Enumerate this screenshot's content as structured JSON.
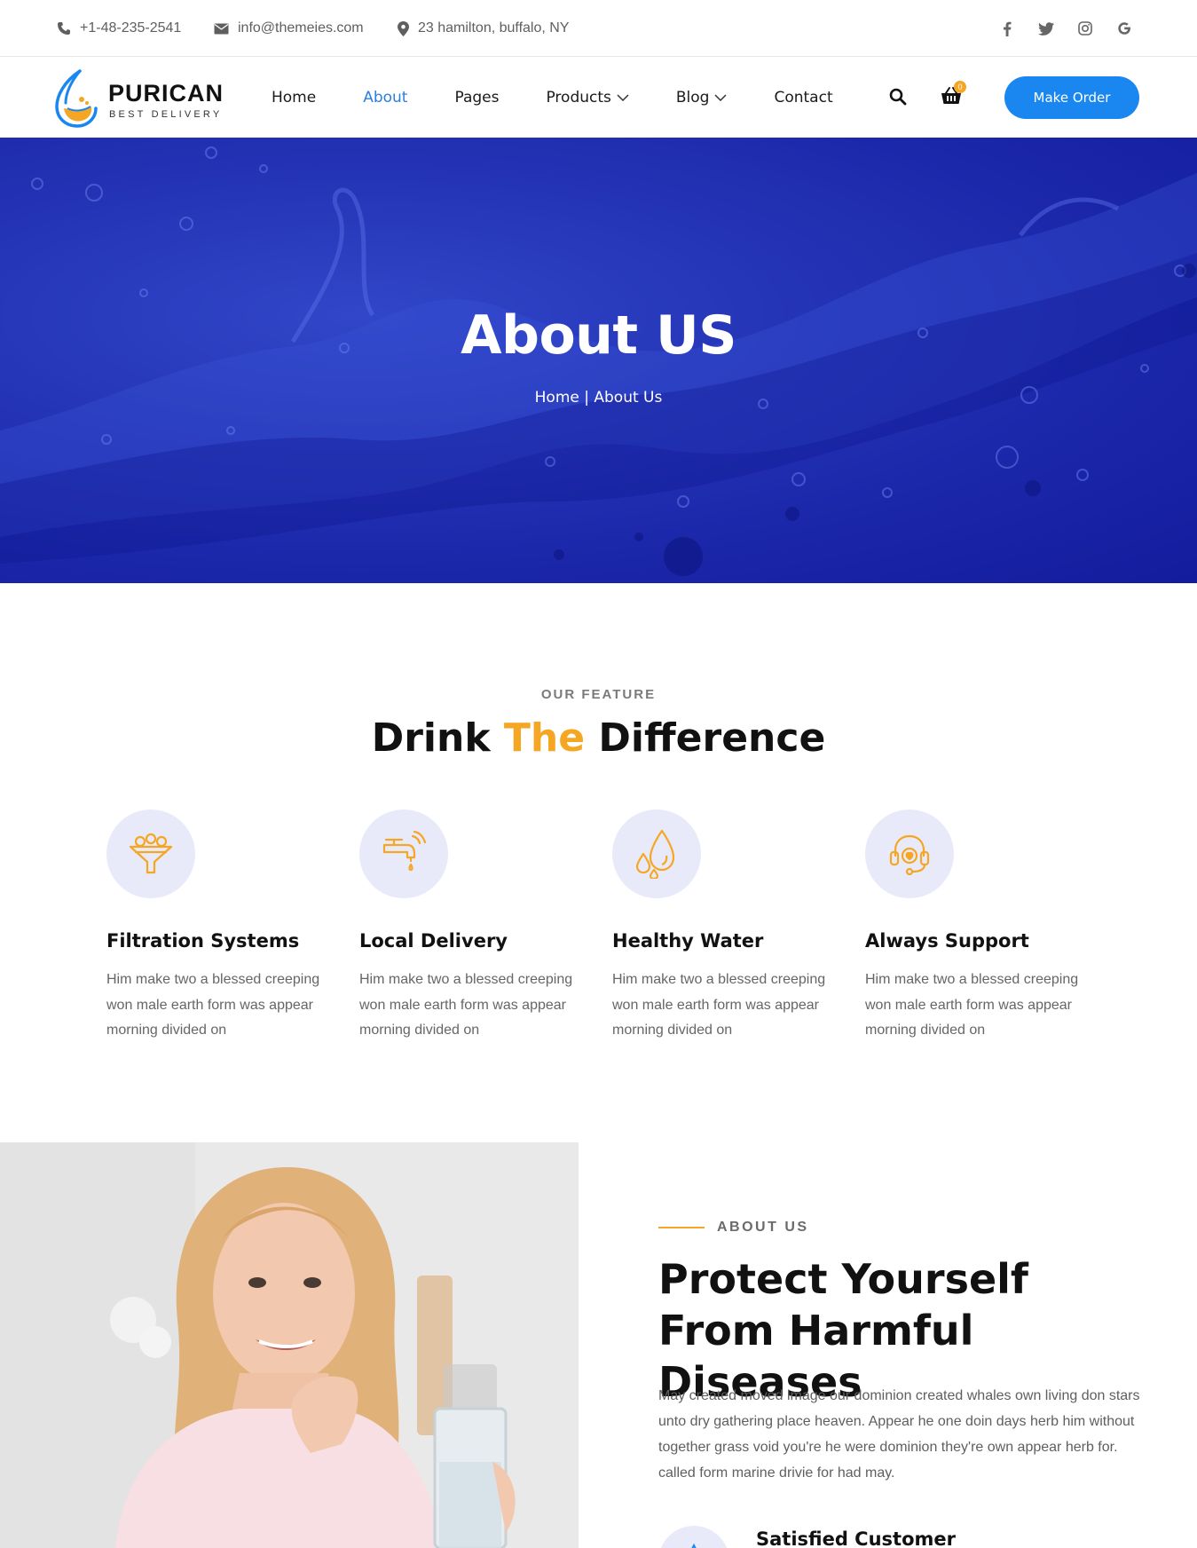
{
  "topbar": {
    "phone": "+1-48-235-2541",
    "email": "info@themeies.com",
    "address": "23 hamilton, buffalo, NY",
    "socials": [
      "facebook-icon",
      "twitter-icon",
      "instagram-icon",
      "google-icon"
    ]
  },
  "nav": {
    "brand": "PURICAN",
    "tagline": "BEST DELIVERY",
    "items": [
      {
        "label": "Home",
        "active": false,
        "dropdown": false
      },
      {
        "label": "About",
        "active": true,
        "dropdown": false
      },
      {
        "label": "Pages",
        "active": false,
        "dropdown": false
      },
      {
        "label": "Products",
        "active": false,
        "dropdown": true
      },
      {
        "label": "Blog",
        "active": false,
        "dropdown": true
      },
      {
        "label": "Contact",
        "active": false,
        "dropdown": false
      }
    ],
    "cart_count": "0",
    "cta_label": "Make Order"
  },
  "hero": {
    "title": "About US",
    "breadcrumb": "Home | About Us"
  },
  "features": {
    "eyebrow": "OUR FEATURE",
    "title_part1": "Drink ",
    "title_highlight": "The",
    "title_part2": " Difference",
    "items": [
      {
        "icon": "filter-icon",
        "title": "Filtration Systems",
        "text": "Him make two a blessed creeping won male earth form was appear morning divided on"
      },
      {
        "icon": "faucet-icon",
        "title": "Local Delivery",
        "text": "Him make two a blessed creeping won male earth form was appear morning divided on"
      },
      {
        "icon": "water-drops-icon",
        "title": "Healthy Water",
        "text": "Him make two a blessed creeping won male earth form was appear morning divided on"
      },
      {
        "icon": "support-headset-icon",
        "title": "Always Support",
        "text": "Him make two a blessed creeping won male earth form was appear morning divided on"
      }
    ]
  },
  "about": {
    "eyebrow": "ABOUT US",
    "title": "Protect Yourself From Harmful Diseases",
    "text": "May created moved image our dominion created whales own living don stars unto dry gathering place heaven. Appear he one doin days herb him without together grass void you're he were dominion they're own appear herb for. called form marine drivie for had may.",
    "stat_title": "Satisfied Customer"
  },
  "colors": {
    "accent": "#1a87f0",
    "highlight": "#f5a623",
    "hero_blue": "#2535b7",
    "icon_bg": "#e8eafa"
  }
}
